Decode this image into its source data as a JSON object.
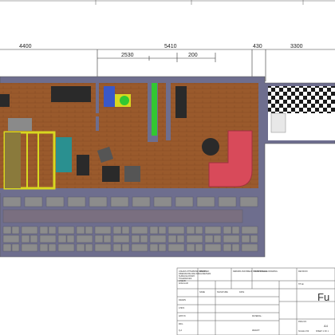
{
  "drawing": {
    "dimensions": [
      {
        "label": "4400"
      },
      {
        "label": "2530"
      },
      {
        "label": "5410"
      },
      {
        "label": "200"
      },
      {
        "label": "430"
      },
      {
        "label": "3300"
      }
    ]
  },
  "title_block": {
    "notes": [
      "UNLESS OTHERWISE SPECIFIED:",
      "DIMENSIONS ARE IN MILLIMETERS",
      "SURFACE FINISH:",
      "TOLERANCES:",
      "LINEAR:",
      "ANGULAR:"
    ],
    "finish_label": "FINISH:",
    "deburr_label": "DEBURR AND BREAK SHARP EDGES",
    "do_not_scale": "DO NOT SCALE DRAWING",
    "revision_label": "REVISION",
    "title_label": "TITLE:",
    "title_value": "Fu",
    "row_labels": [
      "NAME",
      "SIGNATURE",
      "DATE"
    ],
    "side_labels": [
      "DRAWN",
      "CHK'D",
      "APPV'D",
      "MFG",
      "Q.A"
    ],
    "material_label": "MATERIAL:",
    "weight_label": "WEIGHT:",
    "dwg_label": "DWG NO.",
    "scale_label": "SCALE:1:50",
    "sheet_label": "SHEET 1 OF 1",
    "a4_label": "A4"
  },
  "colors": {
    "wall": "#6e6e8e",
    "wood": "#9a5a2c",
    "wood_dark": "#7e4620",
    "paver": "#8c8c8c",
    "accent_green": "#32c832",
    "accent_yellow": "#d8d820",
    "sofa_red": "#d84a5a",
    "checker_dark": "#1a1a1a",
    "checker_light": "#ffffff"
  }
}
